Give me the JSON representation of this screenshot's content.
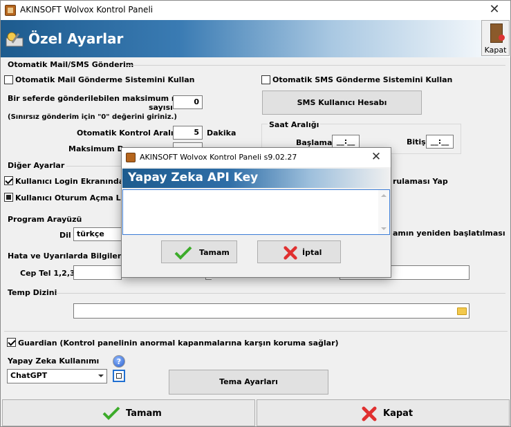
{
  "window": {
    "title": "AKINSOFT Wolvox Kontrol Paneli",
    "close": "✕"
  },
  "header": {
    "title": "Özel Ayarlar",
    "close_label": "Kapat"
  },
  "auto_section": {
    "title": "Otomatik Mail/SMS Gönderim",
    "mail_checkbox": "Otomatik Mail Gönderme Sistemini Kullan",
    "sms_checkbox": "Otomatik SMS Gönderme Sistemini Kullan",
    "max_mail_label_1": "Bir seferde gönderilebilen maksimum mail",
    "max_mail_label_2": "sayısı",
    "max_mail_value": "0",
    "unlimited_note": "(Sınırsız gönderim için \"0\" değerini giriniz.)",
    "interval_label": "Otomatik Kontrol Aralığı",
    "interval_value": "5",
    "interval_unit": "Dakika",
    "max_label": "Maksimum De",
    "sms_account_button": "SMS Kullanıcı Hesabı",
    "time_range_title": "Saat Aralığı",
    "start_label": "Başlama",
    "start_value": "__:__",
    "end_label": "Bitiş",
    "end_value": "__:__"
  },
  "other_section": {
    "title": "Diğer Ayarlar",
    "login_screen": "Kullanıcı Login Ekranında Pa",
    "login_suffix": "rulaması Yap",
    "session_log": "Kullanıcı Oturum Açma Logu"
  },
  "ui_section": {
    "title": "Program Arayüzü",
    "lang_label": "Dil",
    "lang_value": "türkçe",
    "restart_note": "amın yeniden başlatılması"
  },
  "error_section": {
    "title": "Hata ve Uyarılarda Bilgilendir",
    "phone_label": "Cep Tel 1,2,3"
  },
  "temp_section": {
    "title": "Temp Dizini"
  },
  "guardian": {
    "label": "Guardian (Kontrol panelinin anormal kapanmalarına karşın koruma sağlar)"
  },
  "ai": {
    "label": "Yapay Zeka Kullanımı",
    "value": "ChatGPT",
    "help": "?",
    "theme_button": "Tema Ayarları"
  },
  "footer": {
    "ok": "Tamam",
    "close": "Kapat"
  },
  "dialog": {
    "title": "AKINSOFT Wolvox Kontrol Paneli s9.02.27",
    "close": "✕",
    "header": "Yapay Zeka API Key",
    "memo_value": "",
    "ok": "Tamam",
    "cancel": "İptal"
  }
}
